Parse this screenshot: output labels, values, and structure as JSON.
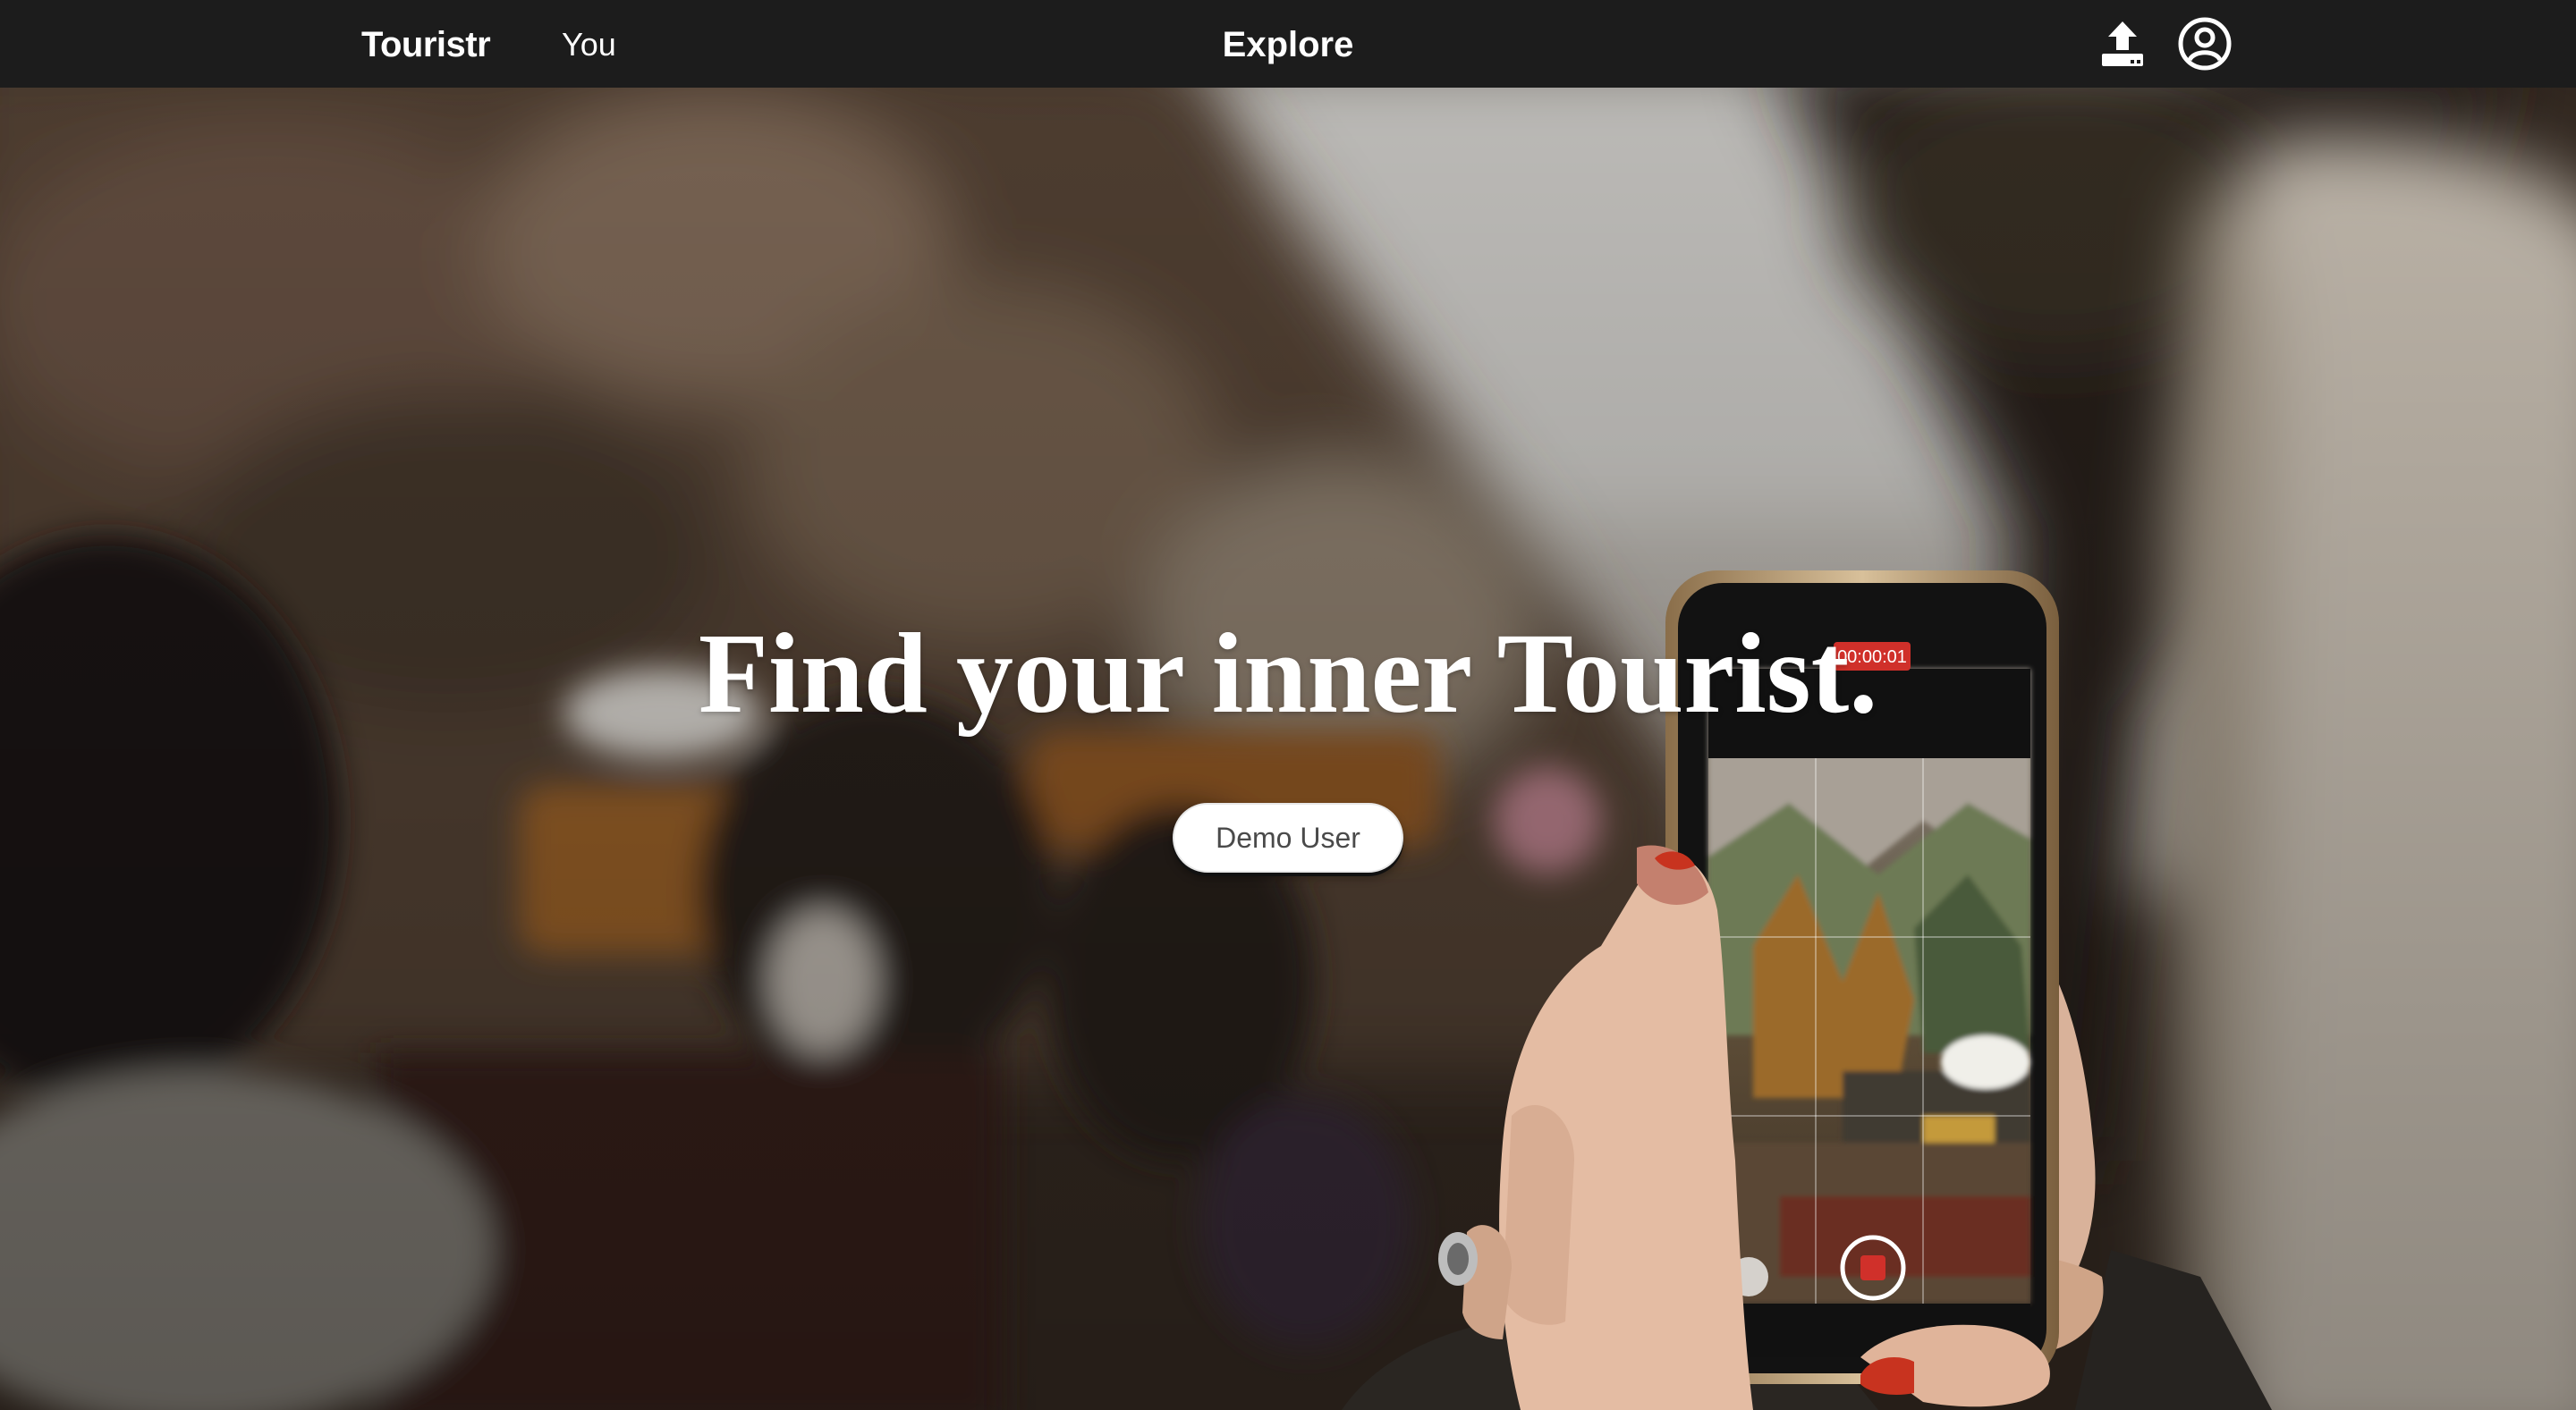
{
  "header": {
    "brand": "Touristr",
    "nav_you": "You",
    "nav_explore": "Explore",
    "icons": [
      "upload-icon",
      "account-icon"
    ]
  },
  "hero": {
    "tagline": "Find your inner Tourist.",
    "demo_button_label": "Demo User",
    "phone_timer": "00:00:01"
  },
  "colors": {
    "navbar": "#1c1c1c",
    "text": "#ffffff",
    "recording_badge": "#d0302a",
    "button_bg": "#ffffff",
    "button_text": "#4a4a4a"
  }
}
